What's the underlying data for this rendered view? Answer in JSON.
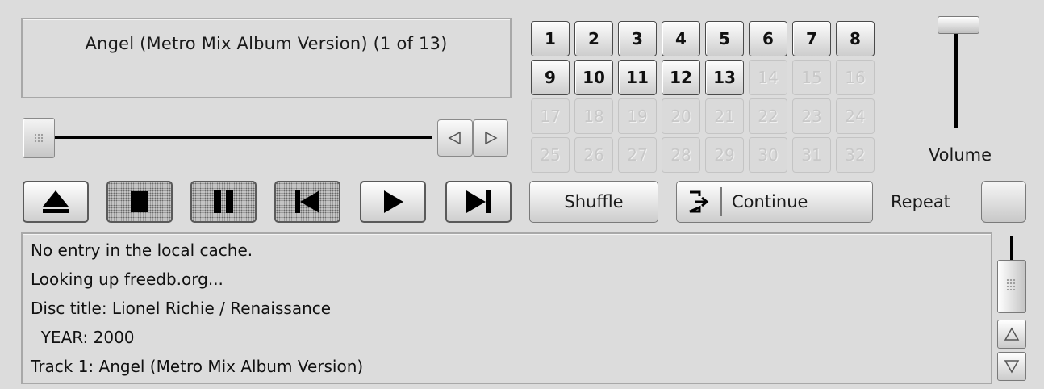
{
  "now_playing": {
    "title": "Angel (Metro Mix Album Version) (1 of 13)"
  },
  "position": {
    "progress": 0.0
  },
  "seek": {
    "back_icon": "triangle-left-icon",
    "forward_icon": "triangle-right-icon"
  },
  "tracks": {
    "items": [
      "1",
      "2",
      "3",
      "4",
      "5",
      "6",
      "7",
      "8",
      "9",
      "10",
      "11",
      "12",
      "13",
      "14",
      "15",
      "16",
      "17",
      "18",
      "19",
      "20",
      "21",
      "22",
      "23",
      "24",
      "25",
      "26",
      "27",
      "28",
      "29",
      "30",
      "31",
      "32"
    ],
    "available_count": 13
  },
  "volume": {
    "label": "Volume",
    "level": 1.0
  },
  "transport": {
    "buttons": [
      {
        "name": "eject-button",
        "icon": "eject-icon"
      },
      {
        "name": "stop-button",
        "icon": "stop-icon"
      },
      {
        "name": "pause-button",
        "icon": "pause-icon"
      },
      {
        "name": "previous-track-button",
        "icon": "skip-back-icon"
      },
      {
        "name": "play-button",
        "icon": "play-icon"
      },
      {
        "name": "next-track-button",
        "icon": "skip-forward-icon"
      }
    ]
  },
  "controls": {
    "shuffle_label": "Shuffle",
    "continue_label": "Continue",
    "continue_icon": "continue-arrow-icon",
    "repeat_label": "Repeat"
  },
  "log": {
    "lines": [
      "No entry in the local cache.",
      "Looking up freedb.org...",
      "Disc title: Lionel Richie / Renaissance",
      "  YEAR: 2000",
      "Track 1: Angel (Metro Mix Album Version)"
    ]
  },
  "colors": {
    "background": "#dcdcdc",
    "text": "#1a1a1a",
    "disabled_text": "#c8c8c8"
  }
}
